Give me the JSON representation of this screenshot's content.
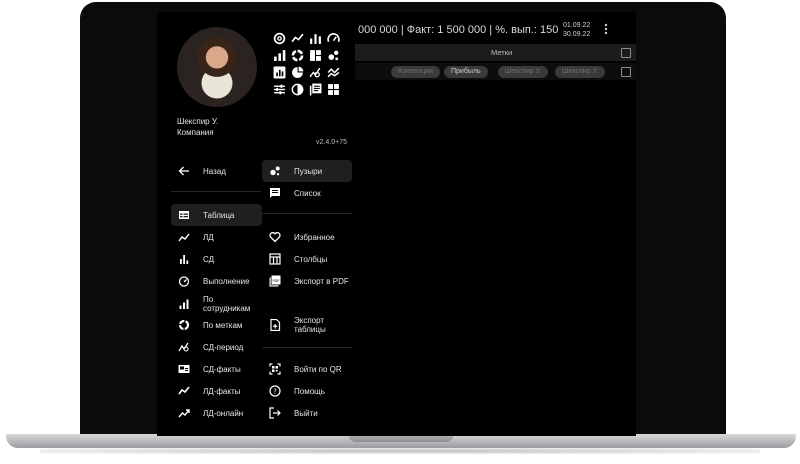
{
  "user": {
    "name": "Шекспир У.",
    "company": "Компания"
  },
  "app": {
    "version": "v2.4.0+75"
  },
  "header": {
    "stats": "000 000 | Факт: 1 500 000 | %. вып.: 150",
    "date_from": "01.09.22",
    "date_to": "30.09.22"
  },
  "table": {
    "column_title": "Метки",
    "chips": [
      "Конвенция",
      "Прибыль",
      "Шекспир У.",
      "Шекспир У."
    ]
  },
  "menu_left": [
    {
      "label": "Назад",
      "icon": "arrow-left-icon"
    },
    {
      "label": "Таблица",
      "icon": "table-icon"
    },
    {
      "label": "ЛД",
      "icon": "trending-icon"
    },
    {
      "label": "СД",
      "icon": "bar-chart-icon"
    },
    {
      "label": "Выполнение",
      "icon": "speedometer-icon"
    },
    {
      "label": "По сотрудникам",
      "icon": "signal-bars-icon"
    },
    {
      "label": "По меткам",
      "icon": "donut-icon"
    },
    {
      "label": "СД-период",
      "icon": "chart-zoom-icon"
    },
    {
      "label": "СД-факты",
      "icon": "featured-video-icon"
    },
    {
      "label": "ЛД-факты",
      "icon": "show-chart-icon"
    },
    {
      "label": "ЛД-онлайн",
      "icon": "trending-up-icon"
    }
  ],
  "menu_right": [
    {
      "label": "Пузыри",
      "icon": "bubbles-icon"
    },
    {
      "label": "Список",
      "icon": "list-message-icon"
    },
    {
      "label": "Избранное",
      "icon": "heart-icon"
    },
    {
      "label": "Столбцы",
      "icon": "columns-icon"
    },
    {
      "label": "Экспорт в PDF",
      "icon": "pdf-icon"
    },
    {
      "label": "Экспорт таблицы",
      "icon": "export-file-icon"
    },
    {
      "label": "Войти по QR",
      "icon": "qr-scan-icon"
    },
    {
      "label": "Помощь",
      "icon": "help-icon"
    },
    {
      "label": "Выйти",
      "icon": "logout-icon"
    }
  ],
  "colors": {
    "screen_bg": "#000000",
    "active_item_bg": "#1f1f1f",
    "text": "#e6e6e6",
    "chip_bg": "#3a3a3a"
  }
}
